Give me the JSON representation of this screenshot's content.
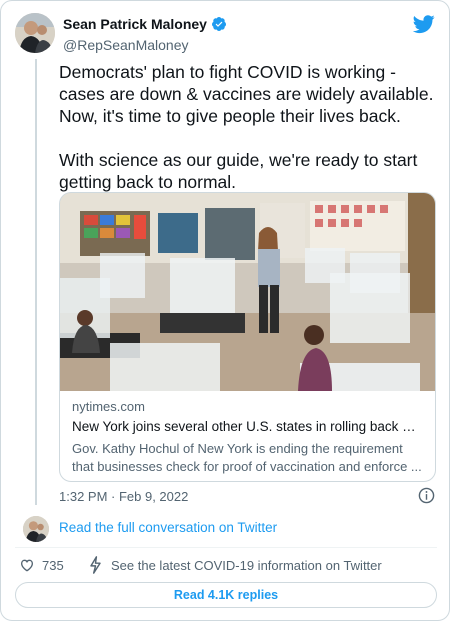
{
  "author": {
    "name": "Sean Patrick Maloney",
    "handle": "@RepSeanMaloney",
    "verified_icon": "verified-badge-icon",
    "avatar_icon": "avatar"
  },
  "brand": {
    "logo": "twitter-bird-icon",
    "color": "#1d9bf0"
  },
  "tweet": {
    "text": "Democrats' plan to fight COVID is working - cases are down & vaccines are widely available. Now, it's time to give people their lives back.\n\nWith science as our guide, we're ready to start getting back to normal.",
    "timestamp": "1:32 PM · Feb 9, 2022"
  },
  "link_card": {
    "domain": "nytimes.com",
    "title": "New York joins several other U.S. states in rolling back mask...",
    "description": "Gov. Kathy Hochul of New York is ending the requirement that businesses check for proof of vaccination and enforce ..."
  },
  "conversation": {
    "label": "Read the full conversation on Twitter"
  },
  "actions": {
    "likes": "735",
    "covid_info": "See the latest COVID-19 information on Twitter",
    "replies_button": "Read 4.1K replies"
  },
  "colors": {
    "link_blue": "#1d9bf0",
    "text": "#0f1419",
    "muted": "#536471",
    "border": "#cfd9de"
  }
}
